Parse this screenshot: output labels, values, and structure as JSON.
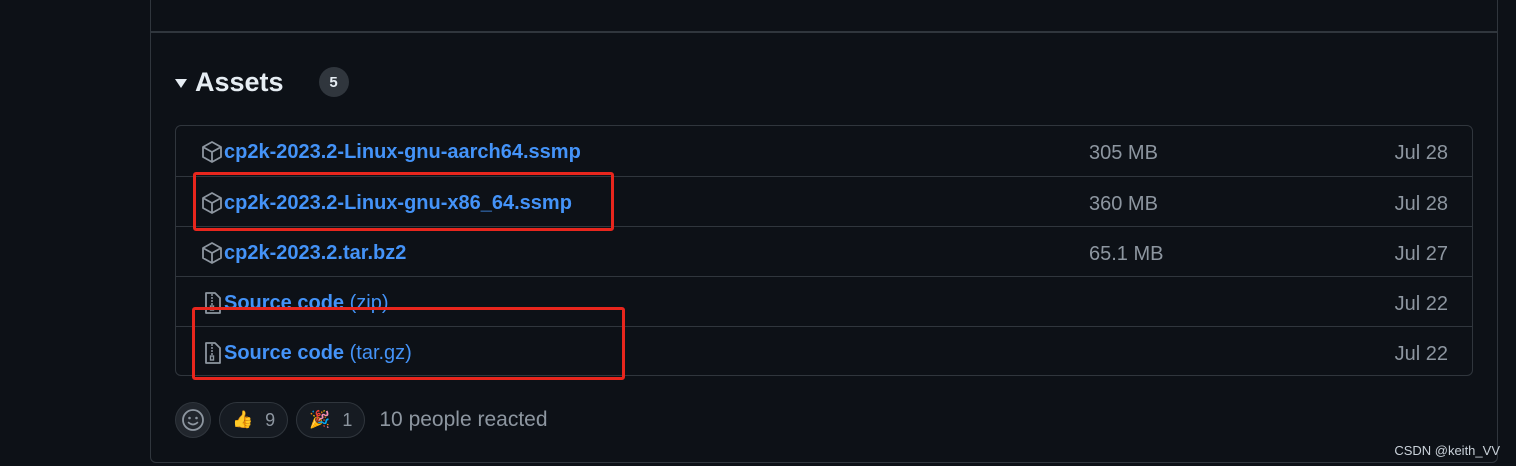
{
  "assets": {
    "title": "Assets",
    "count": "5",
    "items": [
      {
        "icon": "package-icon",
        "name": "cp2k-2023.2-Linux-gnu-aarch64.ssmp",
        "suffix": "",
        "size": "305 MB",
        "date": "Jul 28"
      },
      {
        "icon": "package-icon",
        "name": "cp2k-2023.2-Linux-gnu-x86_64.ssmp",
        "suffix": "",
        "size": "360 MB",
        "date": "Jul 28"
      },
      {
        "icon": "package-icon",
        "name": "cp2k-2023.2.tar.bz2",
        "suffix": "",
        "size": "65.1 MB",
        "date": "Jul 27"
      },
      {
        "icon": "file-zip-icon",
        "name": "Source code",
        "suffix": " (zip)",
        "size": "",
        "date": "Jul 22"
      },
      {
        "icon": "file-zip-icon",
        "name": "Source code",
        "suffix": " (tar.gz)",
        "size": "",
        "date": "Jul 22"
      }
    ]
  },
  "reactions": {
    "items": [
      {
        "emoji": "👍",
        "count": "9"
      },
      {
        "emoji": "🎉",
        "count": "1"
      }
    ],
    "summary": "10 people reacted"
  },
  "watermark": "CSDN @keith_VV",
  "colors": {
    "background": "#0d1117",
    "border": "#30363d",
    "link": "#4493f8",
    "muted": "#8d96a0",
    "highlight": "#e8261d"
  }
}
